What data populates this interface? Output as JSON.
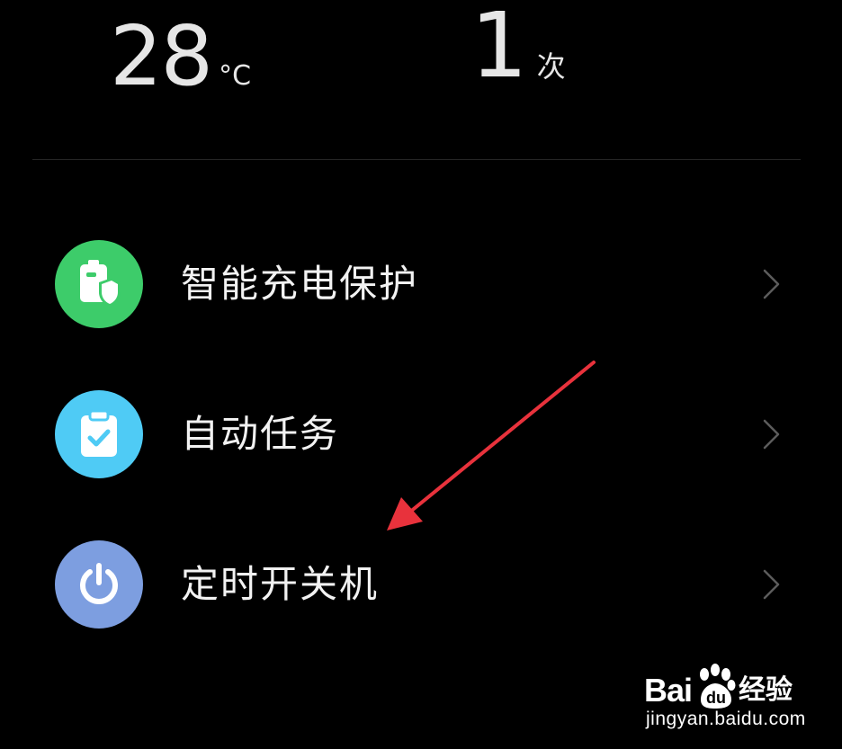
{
  "stats": {
    "temperature": {
      "value": "28",
      "unit": "°C"
    },
    "charge_count": {
      "value": "1",
      "unit": "次"
    }
  },
  "menu": {
    "items": [
      {
        "label": "智能充电保护",
        "icon": "battery-shield-icon",
        "color": "#3dcc6a"
      },
      {
        "label": "自动任务",
        "icon": "clipboard-check-icon",
        "color": "#4fcbf5"
      },
      {
        "label": "定时开关机",
        "icon": "power-icon",
        "color": "#7d9ee0"
      }
    ]
  },
  "annotation": {
    "arrow_color": "#e8323c"
  },
  "watermark": {
    "brand_left": "Bai",
    "brand_right": "du",
    "product": "经验",
    "url": "jingyan.baidu.com"
  }
}
